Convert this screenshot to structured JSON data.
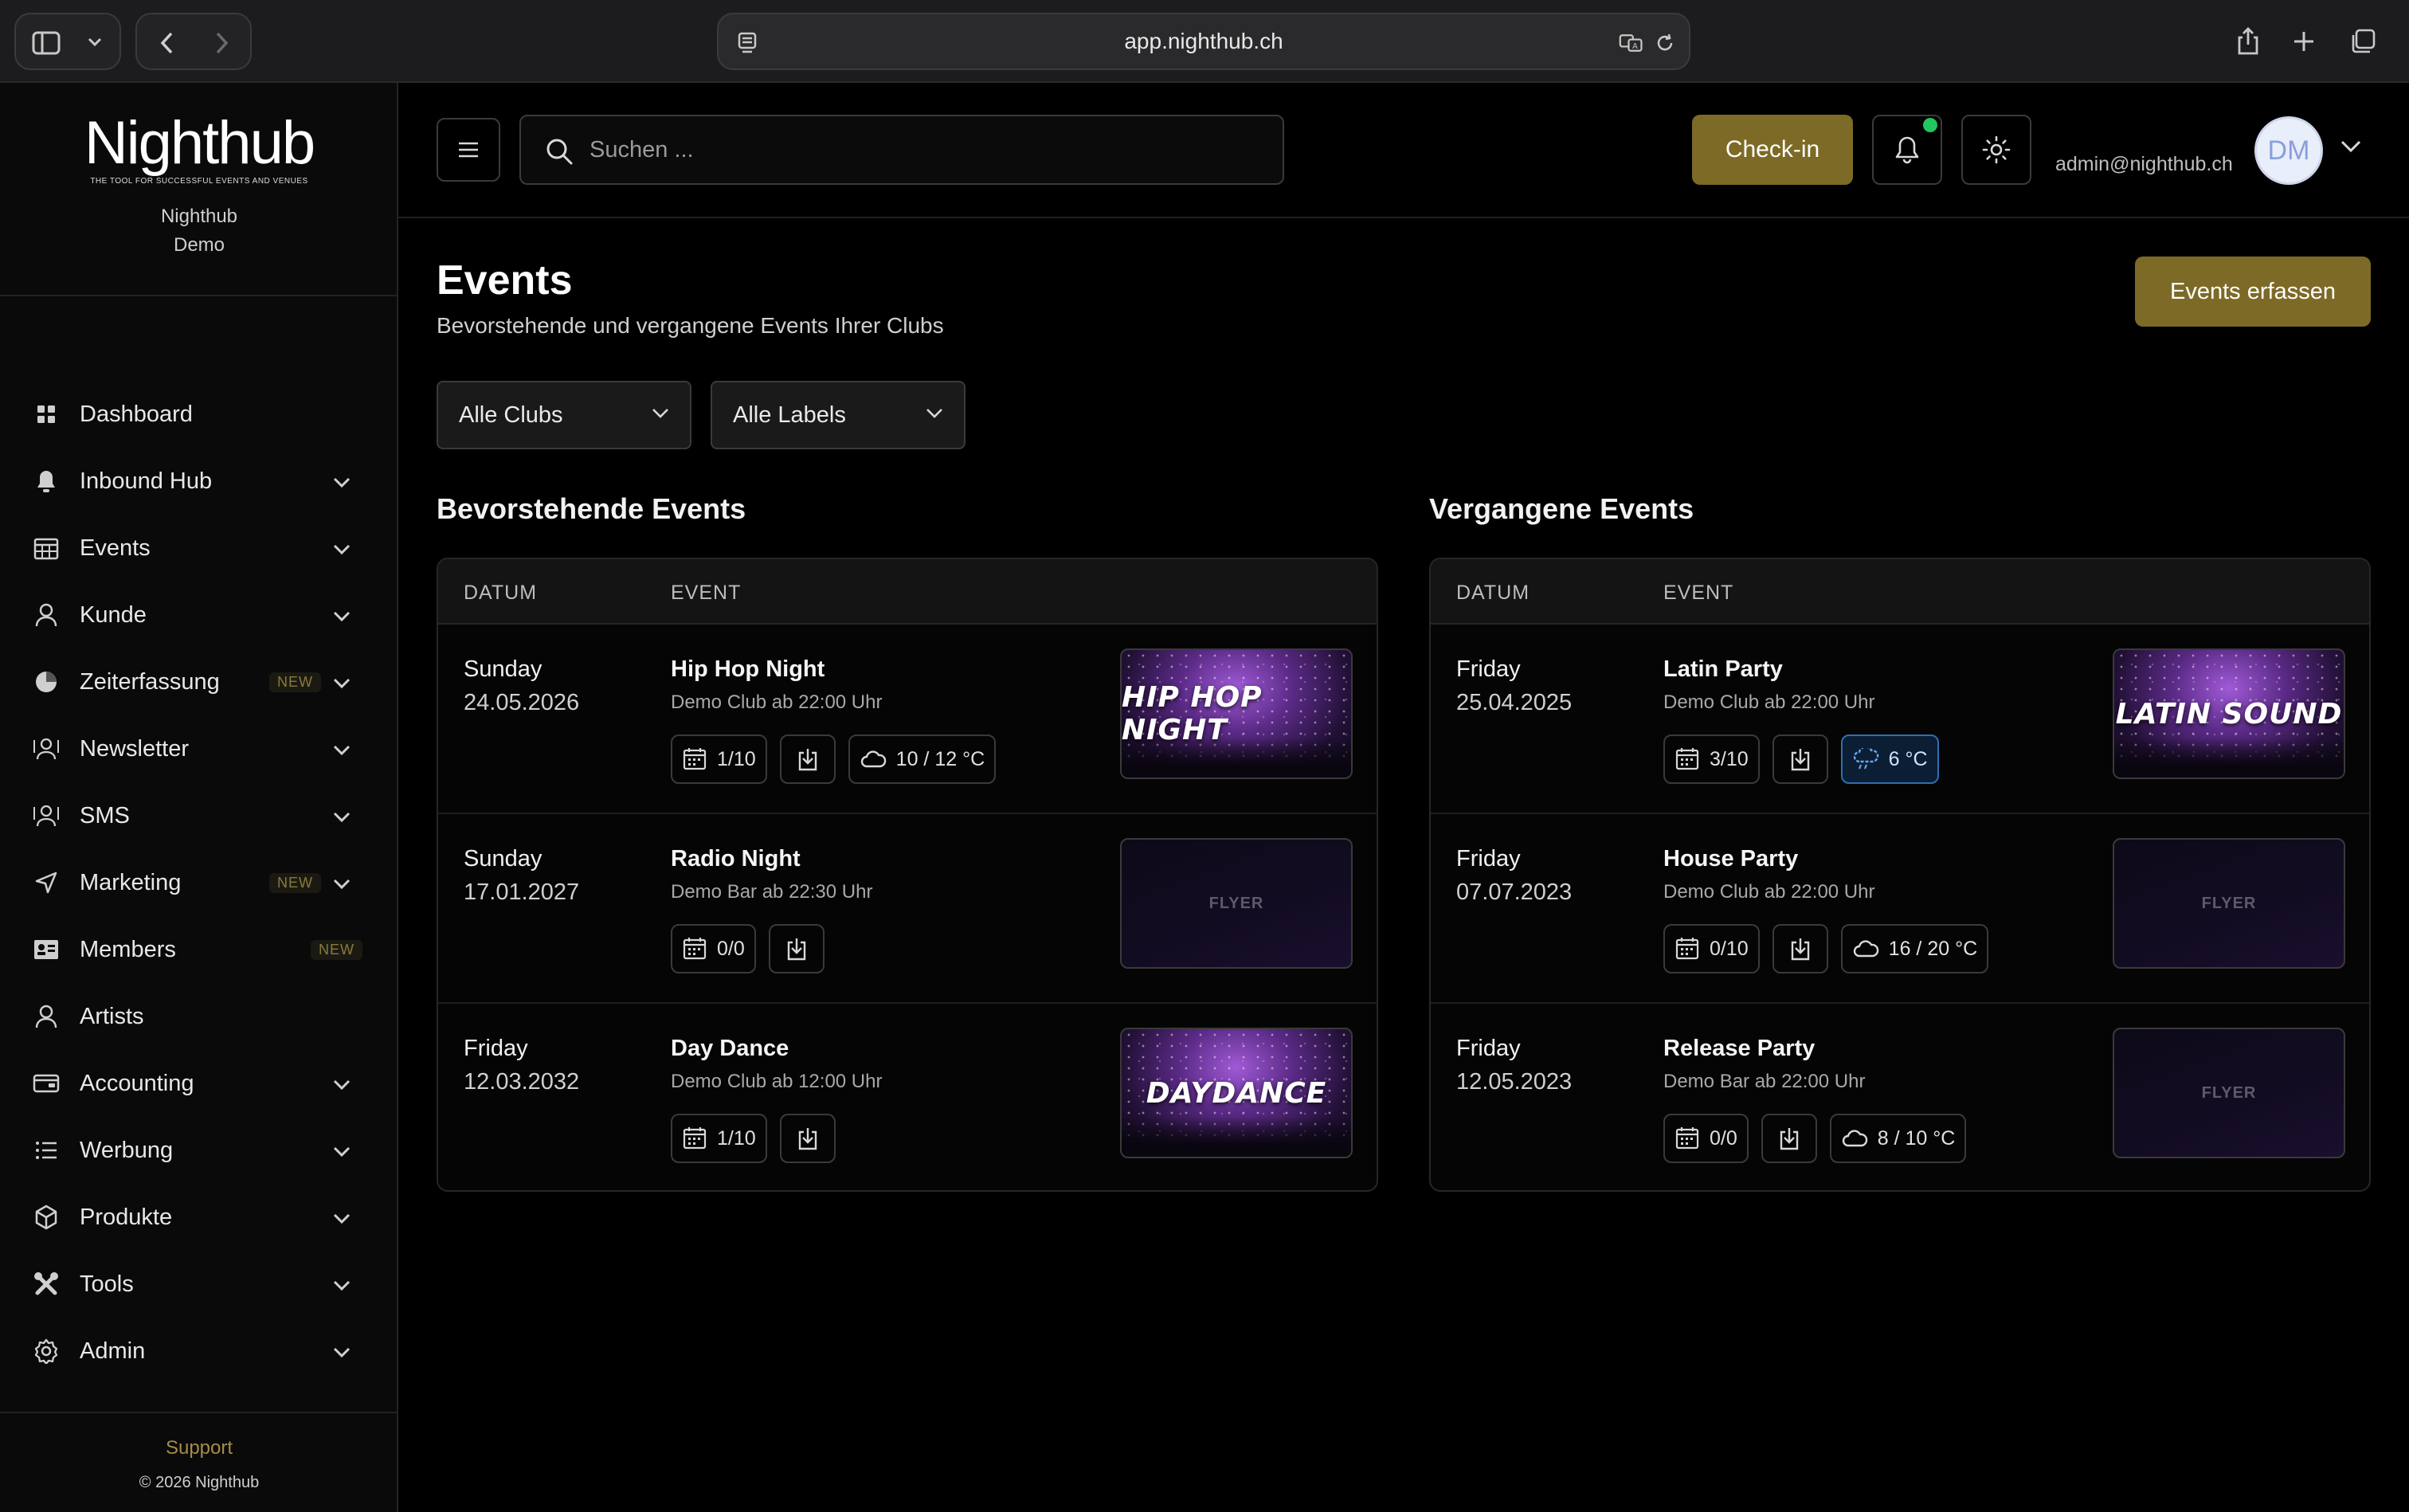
{
  "browser": {
    "url": "app.nighthub.ch"
  },
  "sidebar": {
    "logo": "Nighthub",
    "tagline": "THE TOOL FOR SUCCESSFUL EVENTS AND VENUES",
    "org_line1": "Nighthub",
    "org_line2": "Demo",
    "items": [
      {
        "label": "Dashboard",
        "icon": "grid-icon"
      },
      {
        "label": "Inbound Hub",
        "icon": "bell-icon"
      },
      {
        "label": "Events",
        "icon": "calendar-icon"
      },
      {
        "label": "Kunde",
        "icon": "user-icon"
      },
      {
        "label": "Zeiterfassung",
        "icon": "pie-clock-icon",
        "badge": "NEW"
      },
      {
        "label": "Newsletter",
        "icon": "newsletter-icon"
      },
      {
        "label": "SMS",
        "icon": "sms-icon"
      },
      {
        "label": "Marketing",
        "icon": "send-icon",
        "badge": "NEW"
      },
      {
        "label": "Members",
        "icon": "id-card-icon",
        "badge": "NEW"
      },
      {
        "label": "Artists",
        "icon": "artist-icon"
      },
      {
        "label": "Accounting",
        "icon": "wallet-icon"
      },
      {
        "label": "Werbung",
        "icon": "list-icon"
      },
      {
        "label": "Produkte",
        "icon": "cube-icon"
      },
      {
        "label": "Tools",
        "icon": "tools-icon"
      },
      {
        "label": "Admin",
        "icon": "gear-icon"
      }
    ],
    "support": "Support",
    "copyright": "© 2026 Nighthub"
  },
  "header": {
    "search_placeholder": "Suchen ...",
    "checkin_label": "Check-in",
    "user_email": "admin@nighthub.ch",
    "avatar_initials": "DM"
  },
  "page": {
    "title": "Events",
    "subtitle": "Bevorstehende und vergangene Events Ihrer Clubs",
    "create_label": "Events erfassen",
    "filter_clubs": "Alle Clubs",
    "filter_labels": "Alle Labels"
  },
  "upcoming": {
    "title": "Bevorstehende Events",
    "col_date": "DATUM",
    "col_event": "EVENT",
    "rows": [
      {
        "day": "Sunday",
        "date": "24.05.2026",
        "name": "Hip Hop Night",
        "venue": "Demo Club ab 22:00 Uhr",
        "count": "1/10",
        "weather": "10 / 12 °C",
        "flyer": "HIP HOP NIGHT"
      },
      {
        "day": "Sunday",
        "date": "17.01.2027",
        "name": "Radio Night",
        "venue": "Demo Bar ab 22:30 Uhr",
        "count": "0/0",
        "flyer": "FLYER"
      },
      {
        "day": "Friday",
        "date": "12.03.2032",
        "name": "Day Dance",
        "venue": "Demo Club ab 12:00 Uhr",
        "count": "1/10",
        "flyer": "DAYDANCE"
      }
    ]
  },
  "past": {
    "title": "Vergangene Events",
    "col_date": "DATUM",
    "col_event": "EVENT",
    "rows": [
      {
        "day": "Friday",
        "date": "25.04.2025",
        "name": "Latin Party",
        "venue": "Demo Club ab 22:00 Uhr",
        "count": "3/10",
        "weather": "6 °C",
        "flyer": "LATIN SOUND"
      },
      {
        "day": "Friday",
        "date": "07.07.2023",
        "name": "House Party",
        "venue": "Demo Club ab 22:00 Uhr",
        "count": "0/10",
        "weather": "16 / 20 °C",
        "flyer": "FLYER"
      },
      {
        "day": "Friday",
        "date": "12.05.2023",
        "name": "Release Party",
        "venue": "Demo Bar ab 22:00 Uhr",
        "count": "0/0",
        "weather": "8 / 10 °C",
        "flyer": "FLYER"
      }
    ]
  },
  "colors": {
    "accent": "#7d6a26",
    "badge": "#8a7a3a",
    "online": "#22c55e"
  }
}
